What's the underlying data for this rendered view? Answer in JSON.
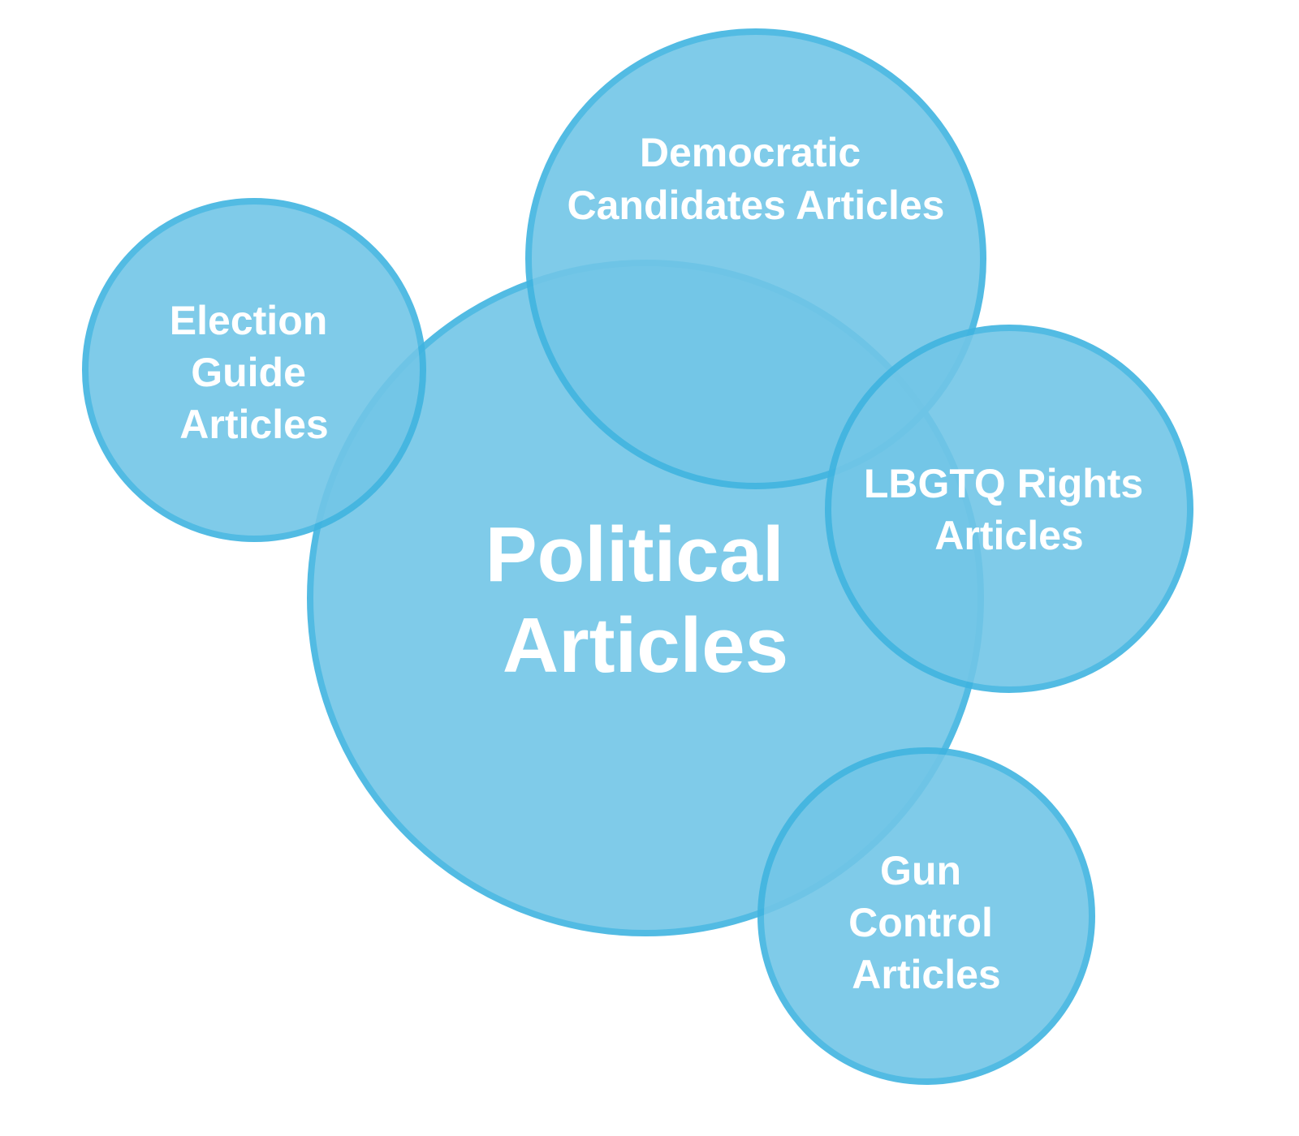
{
  "colors": {
    "bubble_fill": "#72C6E7",
    "bubble_stroke": "#40B4E0",
    "text": "#FFFFFF",
    "background": "#FFFFFF"
  },
  "diagram": {
    "main": {
      "lines": [
        "Political",
        "Articles"
      ]
    },
    "satellites": [
      {
        "id": "election-guide",
        "lines": [
          "Election",
          "Guide",
          "Articles"
        ]
      },
      {
        "id": "democratic-candidates",
        "lines": [
          "Democratic",
          "Candidates Articles"
        ]
      },
      {
        "id": "lbgtq-rights",
        "lines": [
          "LBGTQ Rights",
          "Articles"
        ]
      },
      {
        "id": "gun-control",
        "lines": [
          "Gun",
          "Control",
          "Articles"
        ]
      }
    ]
  }
}
